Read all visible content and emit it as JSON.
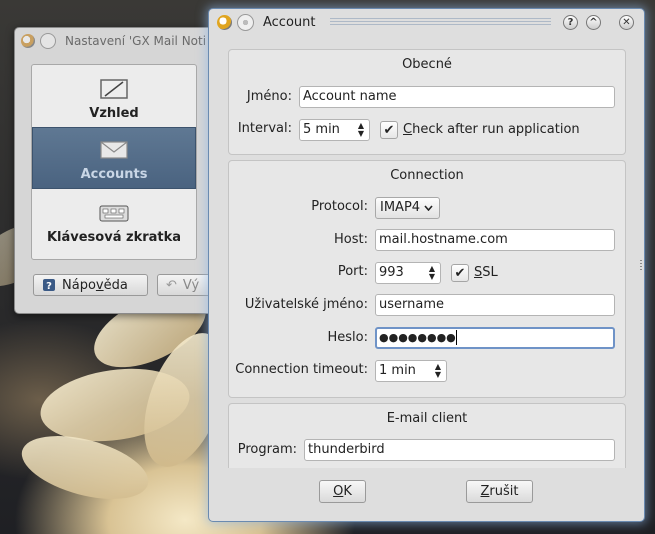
{
  "bg_window": {
    "title": "Nastavení 'GX Mail Noti",
    "categories": [
      {
        "label": "Vzhled",
        "icon": "appearance-icon",
        "selected": false
      },
      {
        "label": "Accounts",
        "icon": "envelope-icon",
        "selected": true
      },
      {
        "label": "Klávesová zkratka",
        "icon": "keyboard-icon",
        "selected": false
      }
    ],
    "help_button": {
      "pre": "Nápo",
      "mn": "v",
      "post": "ěda"
    },
    "default_button": "Vý"
  },
  "dialog": {
    "title": "Account",
    "general": {
      "title": "Obecné",
      "name_label": "Jméno:",
      "name_value": "Account name",
      "interval_label": "Interval:",
      "interval_value": "5 min",
      "check_after_run": {
        "mn": "C",
        "rest": "heck after run application",
        "checked": true
      }
    },
    "connection": {
      "title": "Connection",
      "protocol_label": "Protocol:",
      "protocol_value": "IMAP4",
      "host_label": "Host:",
      "host_value": "mail.hostname.com",
      "port_label": "Port:",
      "port_value": "993",
      "ssl": {
        "mn": "S",
        "rest": "SL",
        "checked": true
      },
      "username_label": "Uživatelské jméno:",
      "username_value": "username",
      "password_label": "Heslo:",
      "password_value": "●●●●●●●●",
      "timeout_label": "Connection timeout:",
      "timeout_value": "1 min"
    },
    "email_client": {
      "title": "E-mail client",
      "program_label": "Program:",
      "program_value": "thunderbird"
    },
    "ok_button": {
      "mn": "O",
      "rest": "K"
    },
    "cancel_button": {
      "mn": "Z",
      "rest": "rušit"
    }
  }
}
